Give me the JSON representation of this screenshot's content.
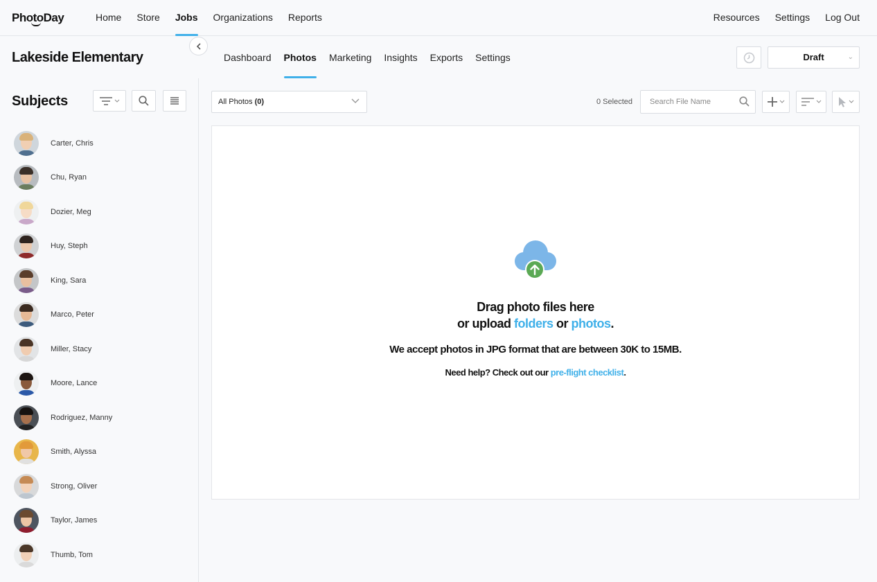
{
  "brand": {
    "logo": "PhotoDay"
  },
  "topnav": {
    "items": [
      "Home",
      "Store",
      "Jobs",
      "Organizations",
      "Reports"
    ],
    "active": "Jobs",
    "right_items": [
      "Resources",
      "Settings",
      "Log Out"
    ]
  },
  "job": {
    "title": "Lakeside Elementary",
    "tabs": [
      "Dashboard",
      "Photos",
      "Marketing",
      "Insights",
      "Exports",
      "Settings"
    ],
    "active_tab": "Photos",
    "status": "Draft"
  },
  "sidebar": {
    "title": "Subjects",
    "subjects": [
      {
        "name": "Carter, Chris"
      },
      {
        "name": "Chu, Ryan"
      },
      {
        "name": "Dozier, Meg"
      },
      {
        "name": "Huy, Steph"
      },
      {
        "name": "King, Sara"
      },
      {
        "name": "Marco, Peter"
      },
      {
        "name": "Miller, Stacy"
      },
      {
        "name": "Moore, Lance"
      },
      {
        "name": "Rodriguez, Manny"
      },
      {
        "name": "Smith, Alyssa"
      },
      {
        "name": "Strong, Oliver"
      },
      {
        "name": "Taylor, James"
      },
      {
        "name": "Thumb, Tom"
      }
    ]
  },
  "toolbar": {
    "filter_label": "All Photos",
    "filter_count": "(0)",
    "selected_text": "0 Selected",
    "search_placeholder": "Search File Name"
  },
  "dropzone": {
    "line1": "Drag photo files here",
    "line2_prefix": "or upload ",
    "line2_link1": "folders",
    "line2_mid": " or ",
    "line2_link2": "photos",
    "line2_suffix": ".",
    "accept_text": "We accept photos in JPG format that are between 30K to 15MB.",
    "help_prefix": "Need help? Check out our ",
    "help_link": "pre-flight checklist",
    "help_suffix": "."
  },
  "colors": {
    "accent": "#3fb0e9",
    "cloud": "#7cb6e8",
    "upload_arrow": "#5ba955"
  }
}
